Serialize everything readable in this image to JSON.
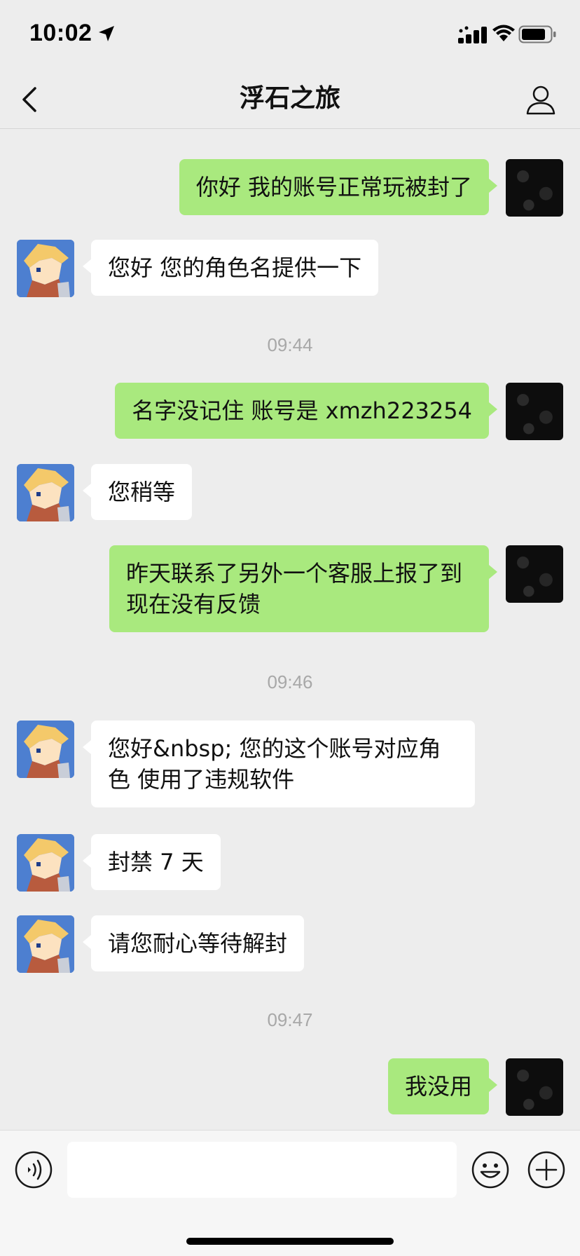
{
  "status_bar": {
    "time": "10:02"
  },
  "nav": {
    "title": "浮石之旅"
  },
  "messages": [
    {
      "side": "me",
      "text": "你好 我的账号正常玩被封了"
    },
    {
      "side": "bot",
      "text": "您好 您的角色名提供一下"
    },
    {
      "type": "time",
      "text": "09:44"
    },
    {
      "side": "me",
      "text": "名字没记住 账号是 xmzh223254"
    },
    {
      "side": "bot",
      "text": "您稍等"
    },
    {
      "side": "me",
      "text": "昨天联系了另外一个客服上报了到现在没有反馈"
    },
    {
      "type": "time",
      "text": "09:46"
    },
    {
      "side": "bot",
      "text": "您好&nbsp; 您的这个账号对应角色 使用了违规软件"
    },
    {
      "side": "bot",
      "text": "封禁 7 天"
    },
    {
      "side": "bot",
      "text": "请您耐心等待解封"
    },
    {
      "type": "time",
      "text": "09:47"
    },
    {
      "side": "me",
      "text": "我没用"
    }
  ],
  "input": {
    "value": ""
  },
  "colors": {
    "bubble_me": "#a9e97e",
    "bubble_bot": "#ffffff",
    "background": "#ededed"
  },
  "icons": [
    "location-arrow-icon",
    "signal-icon",
    "wifi-icon",
    "battery-icon",
    "back-icon",
    "profile-icon",
    "voice-icon",
    "emoji-icon",
    "plus-icon"
  ]
}
